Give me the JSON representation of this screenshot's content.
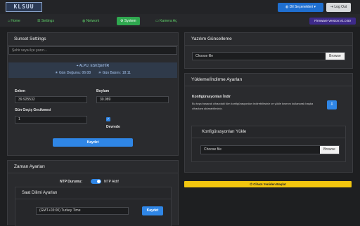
{
  "header": {
    "logo_text": "KLSUU",
    "language_button": "Dil Seçenekleri",
    "logout_button": "Log Out",
    "firmware": "Firmware Version:V1.0.50"
  },
  "nav": {
    "tabs": [
      {
        "label": "Home",
        "icon": "home-icon"
      },
      {
        "label": "Settings",
        "icon": "sliders-icon"
      },
      {
        "label": "Network",
        "icon": "globe-icon"
      },
      {
        "label": "System",
        "icon": "gear-icon",
        "active": true
      },
      {
        "label": "Kamera Aç",
        "icon": "video-icon"
      }
    ]
  },
  "sunset": {
    "title": "Sunset Settings",
    "search_placeholder": "Şehir veya ilçe yazın...",
    "location": "ALPU, ESKİŞEHİR",
    "sunrise": "Gün Doğumu: 06:08",
    "sunset": "Gün Batımı: 18:11",
    "lat_label": "Enlem",
    "lat_value": "39.925532",
    "lon_label": "Boylam",
    "lon_value": "30.989",
    "delay_label": "Gün Geçiş Gecikmesi",
    "delay_value": "1",
    "disabled_label": "Devrede",
    "save_button": "Kaydet"
  },
  "time": {
    "title": "Zaman Ayarları",
    "ntp_status_label": "NTP Durumu:",
    "ntp_toggle_label": "NTP Aktif",
    "timezone_title": "Saat Dilimi Ayarları",
    "timezone_value": "(GMT+03:00) Turkey Time",
    "save_button": "Kaydet"
  },
  "software": {
    "title": "Yazılım Güncelleme",
    "choose_file": "Choose file",
    "browse": "Browse"
  },
  "backup": {
    "title": "Yükleme/İndirme Ayarları",
    "download_title": "Konfigürasyonları İndir",
    "download_desc": "Bu tuşa basarak cihazdaki tüm konfigürasyonları indirebilirsiniz ve yükle kısmını kullanarak başka cihazlara aktarabilirsiniz.",
    "upload_title": "Konfigürasyonları Yükle",
    "choose_file": "Choose file",
    "browse": "Browse"
  },
  "restart": {
    "label": "Cihazı Yeniden Başlat"
  },
  "colors": {
    "accent": "#2f86e6",
    "nav_green": "#2fa84f",
    "restart_yellow": "#e0b400",
    "firmware_purple": "#3e2a8a"
  }
}
